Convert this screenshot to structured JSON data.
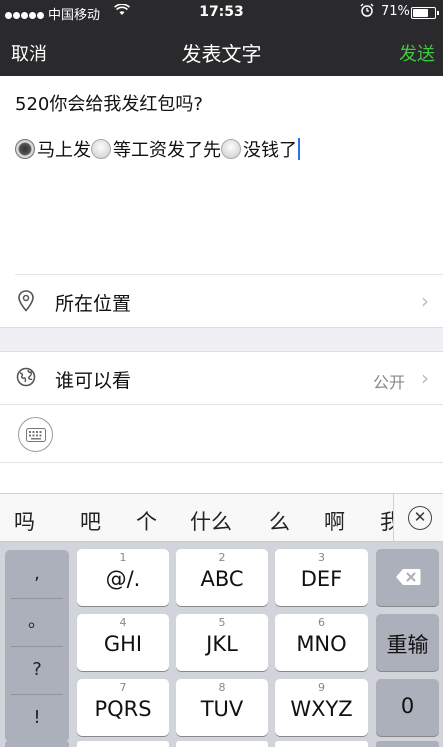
{
  "status_bar": {
    "carrier": "中国移动",
    "wifi_icon": "wifi-icon",
    "time": "17:53",
    "alarm_icon": "alarm-clock-icon",
    "battery_percent": "71%",
    "battery_level": 0.71
  },
  "nav": {
    "cancel": "取消",
    "title": "发表文字",
    "send": "发送",
    "send_color": "#3ec93e"
  },
  "composer": {
    "question": "520你会给我发红包吗?",
    "options": [
      {
        "text": "马上发",
        "selected": true
      },
      {
        "text": "等工资发了先",
        "selected": false
      },
      {
        "text": "没钱了",
        "selected": false
      }
    ]
  },
  "location_row": {
    "icon": "location-pin-icon",
    "label": "所在位置"
  },
  "visibility_row": {
    "icon": "globe-icon",
    "label": "谁可以看",
    "value": "公开"
  },
  "candidates": [
    "吗",
    "吧",
    "个",
    "什么",
    "么",
    "啊",
    "我"
  ],
  "keyboard": {
    "punctuation": [
      ",",
      "。",
      "?",
      "!"
    ],
    "rows": [
      [
        {
          "num": "1",
          "label": "@/."
        },
        {
          "num": "2",
          "label": "ABC"
        },
        {
          "num": "3",
          "label": "DEF"
        }
      ],
      [
        {
          "num": "4",
          "label": "GHI"
        },
        {
          "num": "5",
          "label": "JKL"
        },
        {
          "num": "6",
          "label": "MNO"
        }
      ],
      [
        {
          "num": "7",
          "label": "PQRS"
        },
        {
          "num": "8",
          "label": "TUV"
        },
        {
          "num": "9",
          "label": "WXYZ"
        }
      ]
    ],
    "backspace_icon": "backspace-icon",
    "retype": "重输",
    "zero": "0"
  }
}
